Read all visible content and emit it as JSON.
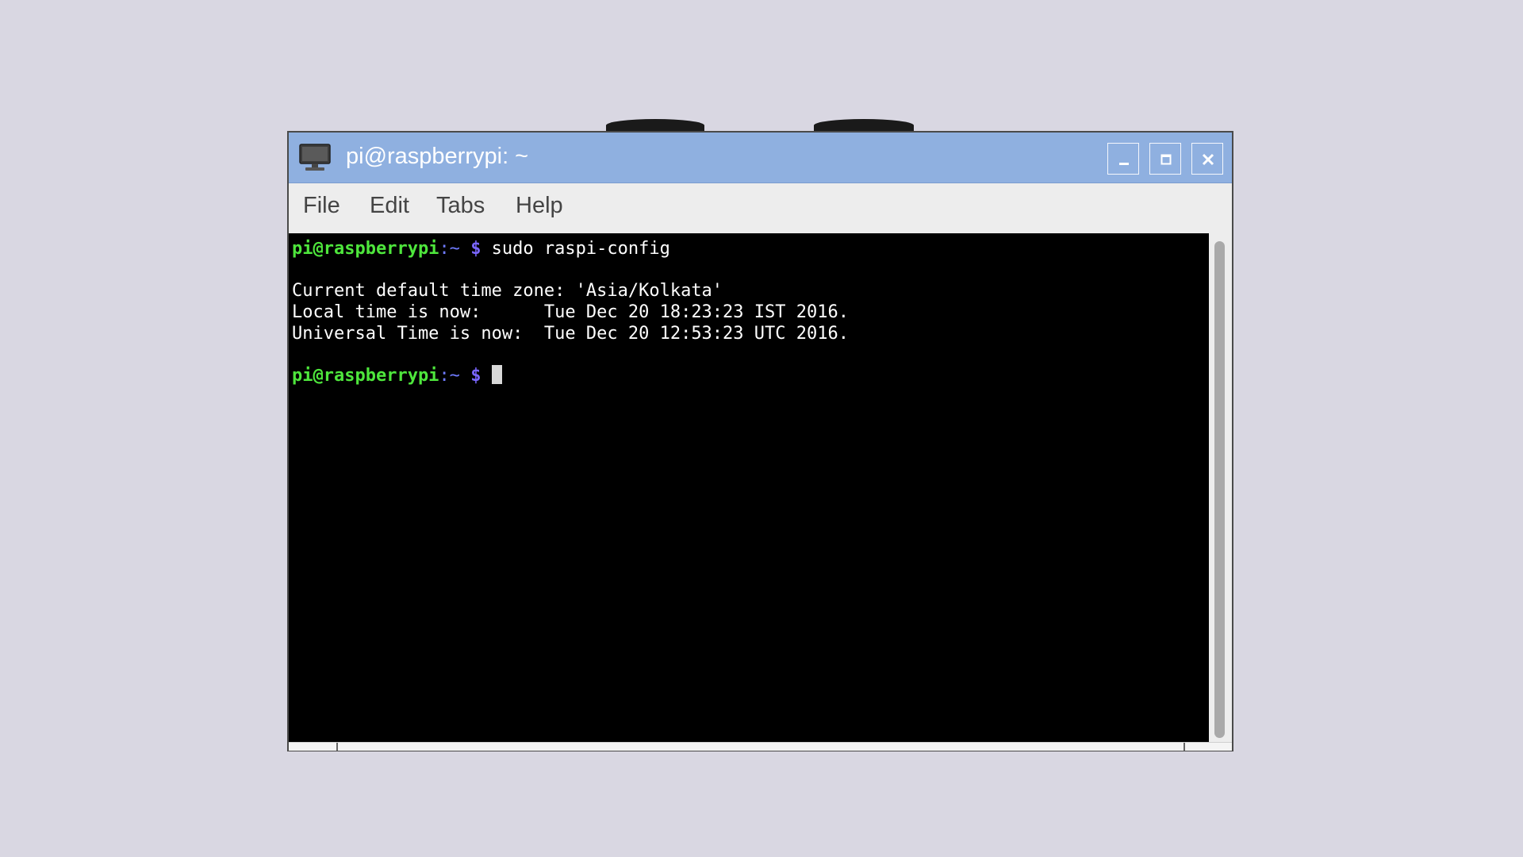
{
  "window": {
    "title": "pi@raspberrypi: ~",
    "title_bar_color": "#8fb0e0",
    "controls": {
      "minimize": "minimize-icon",
      "maximize": "maximize-icon",
      "close": "close-icon"
    }
  },
  "menu": {
    "items": [
      {
        "label": "File"
      },
      {
        "label": "Edit"
      },
      {
        "label": "Tabs"
      },
      {
        "label": "Help"
      }
    ]
  },
  "terminal": {
    "lines": [
      {
        "user": "pi@raspberrypi",
        "path": ":~ ",
        "dollar": "$",
        "command": " sudo raspi-config"
      },
      {
        "text": "Current default time zone: 'Asia/Kolkata'"
      },
      {
        "text": "Local time is now:      Tue Dec 20 18:23:23 IST 2016."
      },
      {
        "text": "Universal Time is now:  Tue Dec 20 12:53:23 UTC 2016."
      },
      {
        "user": "pi@raspberrypi",
        "path": ":~ ",
        "dollar": "$",
        "command": " "
      }
    ],
    "colors": {
      "background": "#000000",
      "text": "#ffffff",
      "prompt_user": "#4ee63c",
      "prompt_path": "#6f7bff"
    }
  }
}
